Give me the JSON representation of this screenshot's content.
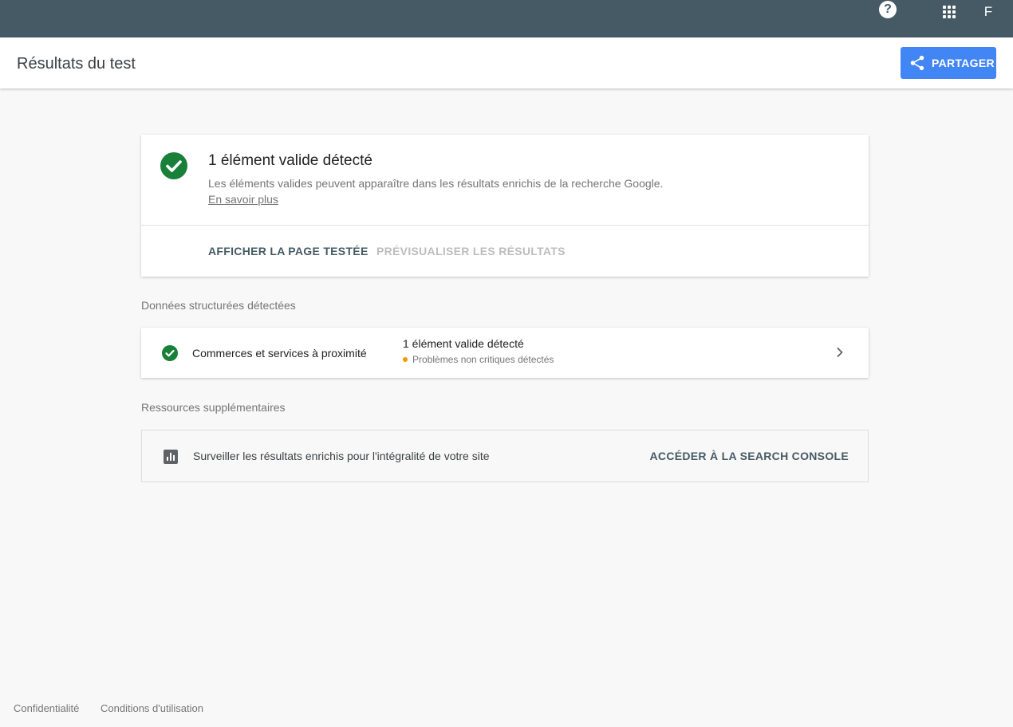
{
  "topbar": {
    "help_icon": "help-circle-icon",
    "apps_icon": "apps-grid-icon",
    "account_initial": "F"
  },
  "header": {
    "title": "Résultats du test",
    "share_label": "PARTAGER",
    "share_icon": "share-icon"
  },
  "summary": {
    "title": "1 élément valide détecté",
    "description": "Les éléments valides peuvent apparaître dans les résultats enrichis de la recherche Google.",
    "learn_more": "En savoir plus",
    "action_view_page": "AFFICHER LA PAGE TESTÉE",
    "action_preview": "PRÉVISUALISER LES RÉSULTATS"
  },
  "structured_data": {
    "section_label": "Données structurées détectées",
    "items": [
      {
        "name": "Commerces et services à proximité",
        "status": "1 élément valide détecté",
        "warning": "Problèmes non critiques détectés"
      }
    ]
  },
  "resources": {
    "section_label": "Ressources supplémentaires",
    "text": "Surveiller les résultats enrichis pour l'intégralité de votre site",
    "link": "ACCÉDER À LA SEARCH CONSOLE"
  },
  "footer": {
    "privacy": "Confidentialité",
    "terms": "Conditions d'utilisation"
  },
  "colors": {
    "topbar": "#455a64",
    "accent": "#4285f4",
    "valid": "#188038",
    "warning": "#f29900"
  }
}
